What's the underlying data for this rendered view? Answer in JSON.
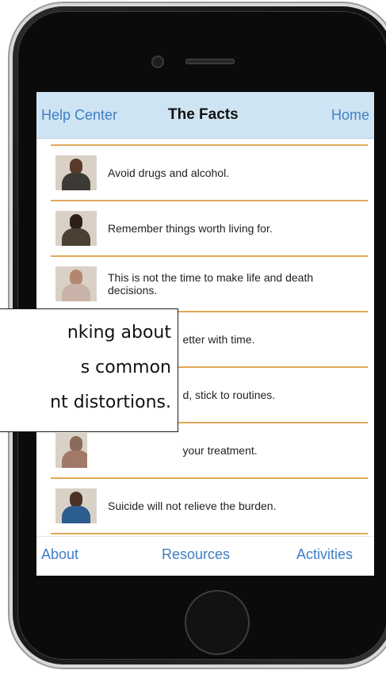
{
  "screen": {
    "nav": {
      "left_label": "Help Center",
      "title": "The Facts",
      "right_label": "Home"
    },
    "list_items": [
      {
        "text": "Avoid drugs and alcohol.",
        "avatar": "avatar-1"
      },
      {
        "text": "Remember things worth living for.",
        "avatar": "avatar-2"
      },
      {
        "text": "This is not the time to make life and death decisions.",
        "avatar": "avatar-3"
      },
      {
        "text": "etter with time.",
        "avatar": "avatar-4"
      },
      {
        "text": "d, stick to routines.",
        "avatar": "avatar-5"
      },
      {
        "text": "your treatment.",
        "avatar": "avatar-6"
      },
      {
        "text": "Suicide will not relieve the burden.",
        "avatar": "avatar-7"
      }
    ],
    "tabs": {
      "about": "About",
      "resources": "Resources",
      "activities": "Activities"
    }
  },
  "callout": {
    "lines": "nking about\ns common\nnt distortions."
  },
  "colors": {
    "nav_bg": "#cfe4f3",
    "accent_blue": "#3f7fc4",
    "divider_orange": "#e2a85a"
  }
}
